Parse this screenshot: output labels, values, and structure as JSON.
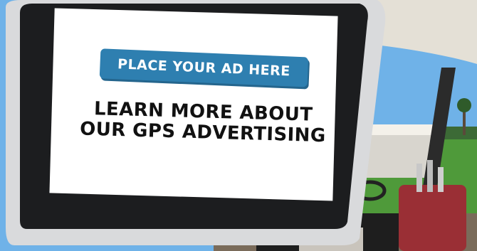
{
  "ad": {
    "button_label": "PLACE YOUR AD HERE",
    "headline_line1": "LEARN MORE ABOUT",
    "headline_line2": "OUR GPS ADVERTISING",
    "button_color": "#2e7fb0"
  },
  "colors": {
    "screen_bezel": "#1c1d1f",
    "mount_frame": "#d9dadc",
    "sky": "#6fb2e8",
    "grass": "#4f9a3a",
    "cart_roof": "#f0ede6",
    "golf_bag": "#9a2f35"
  }
}
